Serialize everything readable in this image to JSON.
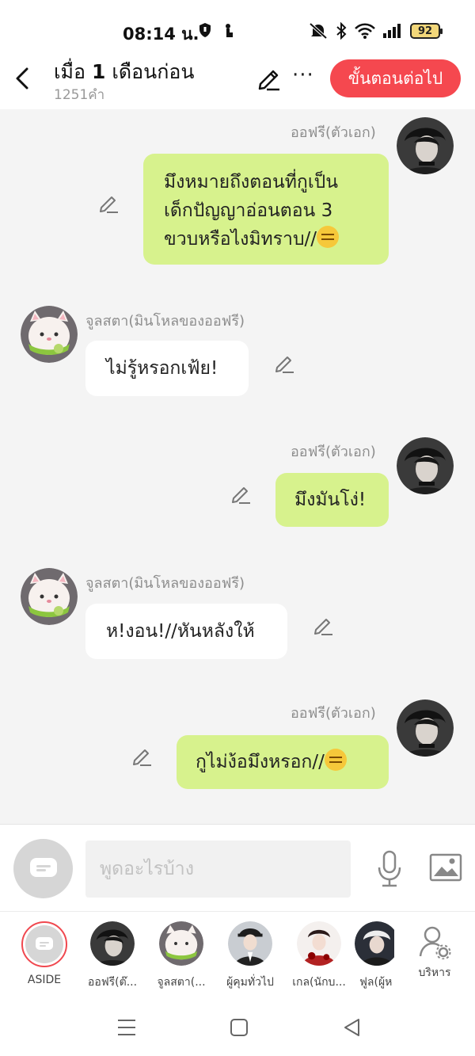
{
  "status_bar": {
    "time": "08:14 น.",
    "battery": "92",
    "icons": [
      "shield-icon",
      "touch-icon",
      "mute-icon",
      "bluetooth-icon",
      "wifi-icon",
      "signal-icon"
    ]
  },
  "header": {
    "title_prefix": "เมื่อ ",
    "title_number": "1",
    "title_suffix": " เดือนก่อน",
    "word_count": "1251",
    "word_unit": "คำ",
    "next_label": "ขั้นตอนต่อไป"
  },
  "messages": [
    {
      "side": "right",
      "sender": "ออฟรี(ตัวเอก)",
      "line1": "มึงหมายถึงตอนที่กูเป็น",
      "line2": "เด็กปัญญาอ่อนตอน 3",
      "line3": "ขวบหรือไงมิทราบ//"
    },
    {
      "side": "left",
      "sender": "จูลสตา(มินโหลของออฟรี)",
      "text": "ไม่รู้หรอกเฟ้ย!"
    },
    {
      "side": "right",
      "sender": "ออฟรี(ตัวเอก)",
      "text": "มึงมันโง่!"
    },
    {
      "side": "left",
      "sender": "จูลสตา(มินโหลของออฟรี)",
      "text": "ห!งอน!//หันหลังให้"
    },
    {
      "side": "right",
      "sender": "ออฟรี(ตัวเอก)",
      "text": "กูไม่ง้อมึงหรอก//"
    }
  ],
  "composer": {
    "placeholder": "พูดอะไรบ้าง"
  },
  "characters": [
    {
      "name": "ASIDE"
    },
    {
      "name": "ออฟรี(ต๊..."
    },
    {
      "name": "จูลสตา(..."
    },
    {
      "name": "ผู้คุมทั่วไป"
    },
    {
      "name": "เกล(นักบ..."
    },
    {
      "name": "ฟูล(ผู้ห"
    },
    {
      "name": "บริหาร"
    }
  ],
  "colors": {
    "accent": "#f5484f",
    "bubble_right": "#d7f28d",
    "bubble_left": "#ffffff",
    "background": "#f4f4f4"
  }
}
